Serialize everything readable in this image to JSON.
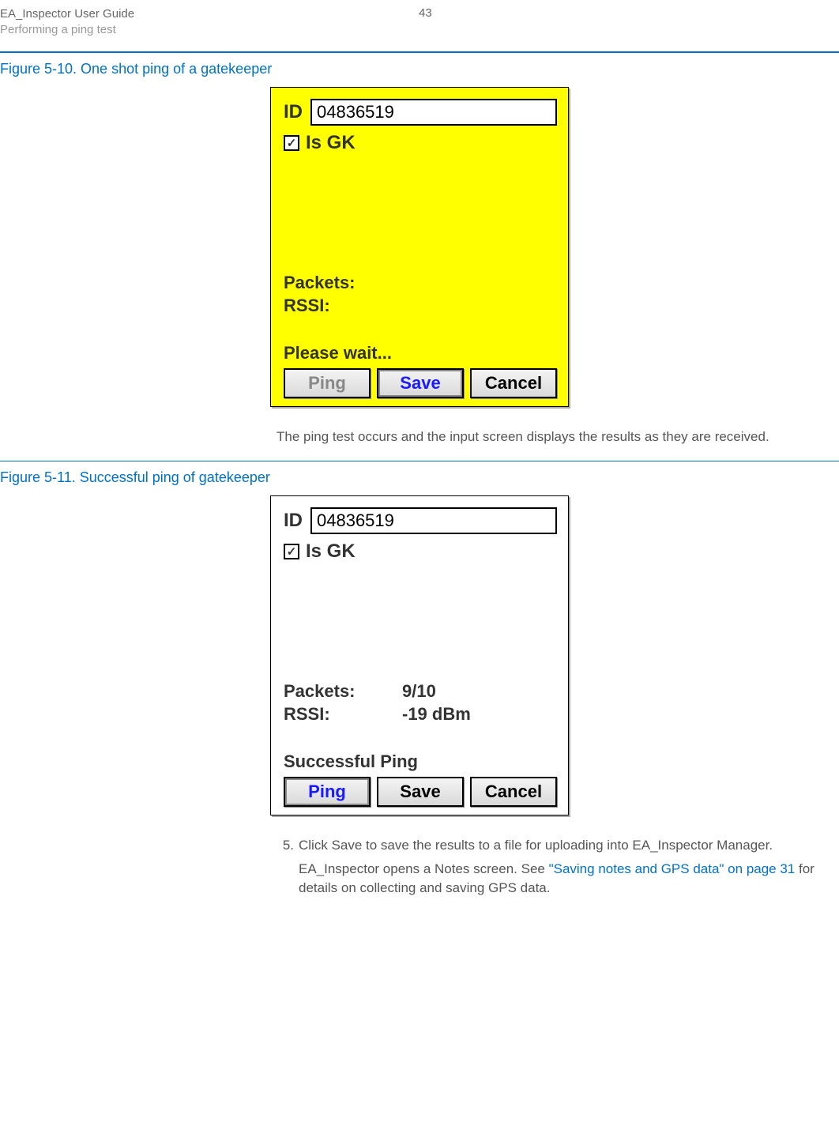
{
  "header": {
    "title": "EA_Inspector User Guide",
    "subtitle": "Performing a ping test",
    "page_number": "43"
  },
  "figure_a": {
    "caption": "Figure 5-10. One shot ping of a gatekeeper",
    "id_label": "ID",
    "id_value": "04836519",
    "is_gk_label": "Is GK",
    "packets_label": "Packets:",
    "rssi_label": "RSSI:",
    "status_text": "Please wait...",
    "buttons": {
      "ping": "Ping",
      "save": "Save",
      "cancel": "Cancel"
    }
  },
  "para_between": "The ping test occurs and the input screen displays the results as they are received.",
  "figure_b": {
    "caption": "Figure 5-11. Successful ping of gatekeeper",
    "id_label": "ID",
    "id_value": "04836519",
    "is_gk_label": "Is GK",
    "packets_label": "Packets:",
    "packets_value": "9/10",
    "rssi_label": "RSSI:",
    "rssi_value": "-19 dBm",
    "status_text": "Successful Ping",
    "buttons": {
      "ping": "Ping",
      "save": "Save",
      "cancel": "Cancel"
    }
  },
  "step5": {
    "number": "5.",
    "pre": "Click ",
    "strong": "Save",
    "post": " to save the results to a file for uploading into EA_Inspector Manager.",
    "next_pre": "EA_Inspector opens a Notes screen. See ",
    "link": "\"Saving notes and GPS data\" on page 31",
    "next_post": " for details on collecting and saving GPS data."
  }
}
